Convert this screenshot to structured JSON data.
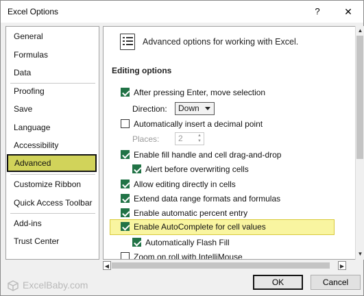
{
  "window": {
    "title": "Excel Options",
    "help": "?",
    "close": "✕"
  },
  "nav": {
    "items": [
      {
        "label": "General"
      },
      {
        "label": "Formulas"
      },
      {
        "label": "Data"
      },
      {
        "label": "Proofing"
      },
      {
        "label": "Save"
      },
      {
        "label": "Language"
      },
      {
        "label": "Accessibility"
      },
      {
        "label": "Advanced",
        "selected": true
      },
      {
        "label": "Customize Ribbon"
      },
      {
        "label": "Quick Access Toolbar"
      },
      {
        "label": "Add-ins"
      },
      {
        "label": "Trust Center"
      }
    ]
  },
  "main": {
    "header": "Advanced options for working with Excel.",
    "section": "Editing options",
    "options": [
      {
        "label": "After pressing Enter, move selection",
        "checked": true
      },
      {
        "label": "Automatically insert a decimal point",
        "checked": false
      },
      {
        "label": "Enable fill handle and cell drag-and-drop",
        "checked": true
      },
      {
        "label": "Alert before overwriting cells",
        "checked": true
      },
      {
        "label": "Allow editing directly in cells",
        "checked": true
      },
      {
        "label": "Extend data range formats and formulas",
        "checked": true
      },
      {
        "label": "Enable automatic percent entry",
        "checked": true
      },
      {
        "label": "Enable AutoComplete for cell values",
        "checked": true
      },
      {
        "label": "Automatically Flash Fill",
        "checked": true
      },
      {
        "label": "Zoom on roll with IntelliMouse",
        "checked": false
      }
    ],
    "direction": {
      "label": "Direction:",
      "value": "Down"
    },
    "places": {
      "label": "Places:",
      "value": "2"
    }
  },
  "footer": {
    "watermark": "ExcelBaby.com",
    "ok": "OK",
    "cancel": "Cancel"
  },
  "colors": {
    "checkbox": "#217346",
    "highlight": "#f9f5a0",
    "selected_nav": "#d1d35a"
  }
}
